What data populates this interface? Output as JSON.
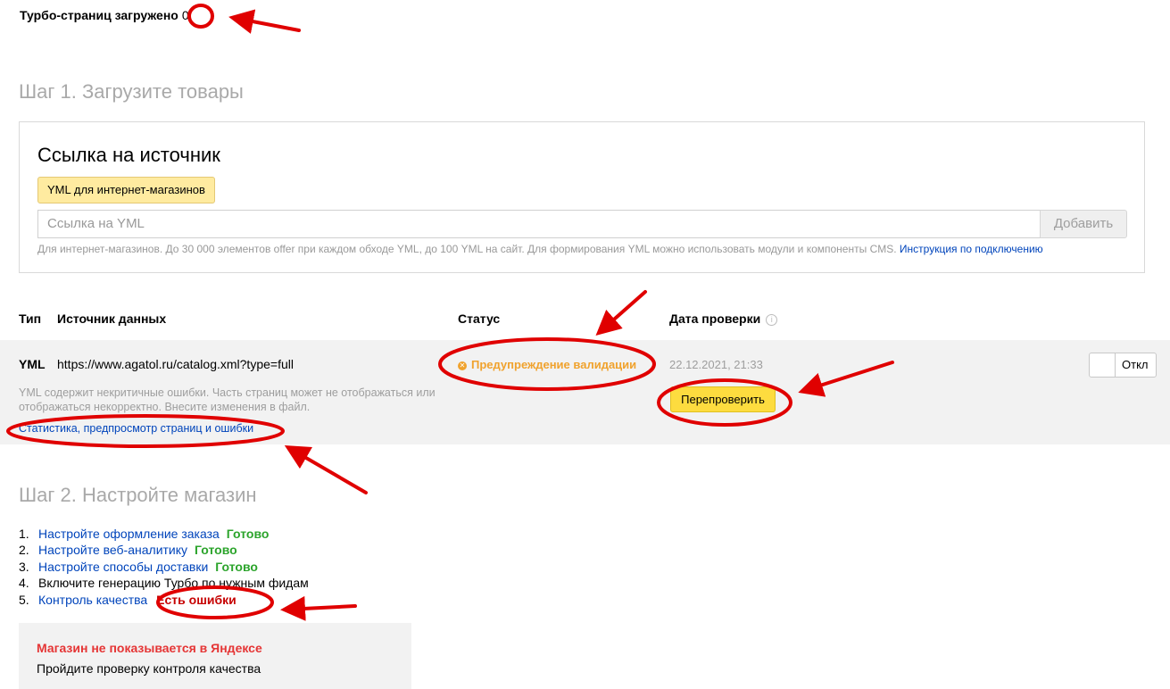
{
  "header": {
    "turbo_pages_label": "Турбо-страниц загружено",
    "turbo_pages_count": "0"
  },
  "step1": {
    "title": "Шаг 1. Загрузите товары",
    "card_title": "Ссылка на источник",
    "chip_label": "YML для интернет-магазинов",
    "input_placeholder": "Ссылка на YML",
    "add_button": "Добавить",
    "hint_text": "Для интернет-магазинов. До 30 000 элементов offer при каждом обходе YML, до 100 YML на сайт. Для формирования YML можно использовать модули и компоненты CMS.",
    "hint_link": "Инструкция по подключению"
  },
  "table": {
    "headers": {
      "type": "Тип",
      "source": "Источник данных",
      "status": "Статус",
      "date": "Дата проверки"
    },
    "row": {
      "type": "YML",
      "source": "https://www.agatol.ru/catalog.xml?type=full",
      "note": "YML содержит некритичные ошибки. Часть страниц может не отображаться или отображаться некорректно. Внесите изменения в файл.",
      "stats_link": "Статистика, предпросмотр страниц и ошибки",
      "status": "Предупреждение валидации",
      "date": "22.12.2021, 21:33",
      "recheck_button": "Перепроверить",
      "toggle_label": "Откл"
    }
  },
  "step2": {
    "title": "Шаг 2. Настройте магазин",
    "items": [
      {
        "num": "1.",
        "label": "Настройте оформление заказа",
        "state": "Готово"
      },
      {
        "num": "2.",
        "label": "Настройте веб-аналитику",
        "state": "Готово"
      },
      {
        "num": "3.",
        "label": "Настройте способы доставки",
        "state": "Готово"
      },
      {
        "num": "4.",
        "label": "Включите генерацию Турбо по нужным фидам",
        "state": ""
      },
      {
        "num": "5.",
        "label": "Контроль качества",
        "state": "Есть ошибки"
      }
    ]
  },
  "alert": {
    "title": "Магазин не показывается в Яндексе",
    "text": "Пройдите проверку контроля качества"
  },
  "colors": {
    "link": "#0044bb",
    "ok": "#2ca42c",
    "error": "#c60000",
    "warning": "#f0a22d",
    "annotation": "#e00000"
  }
}
